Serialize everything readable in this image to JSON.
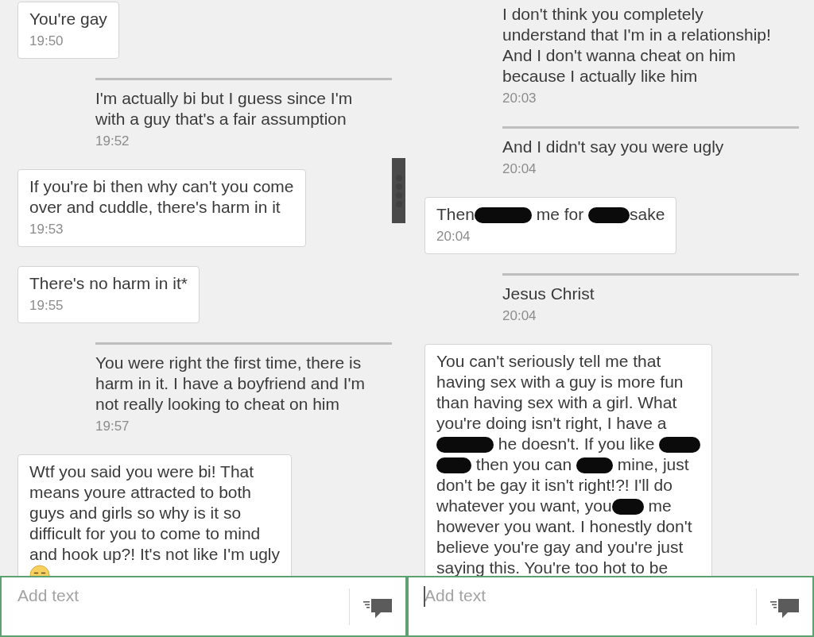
{
  "panels": [
    {
      "messages": [
        {
          "kind": "received",
          "text": "You're gay",
          "time": "19:50"
        },
        {
          "kind": "sent",
          "text": "I'm actually bi but I guess since I'm\nwith a guy that's a fair assumption",
          "time": "19:52"
        },
        {
          "kind": "received",
          "text": "If you're bi then why can't you come\nover and cuddle, there's harm in it",
          "time": "19:53"
        },
        {
          "kind": "received",
          "text": "There's no harm in it*",
          "time": "19:55"
        },
        {
          "kind": "sent",
          "text": "You were right the first time, there is\nharm in it. I have a boyfriend and I'm\nnot really looking to cheat on him",
          "time": "19:57"
        },
        {
          "kind": "received",
          "parts": [
            {
              "kind": "text",
              "text": "Wtf you said you were bi! That\nmeans youre attracted to both\nguys and girls so why is it so\ndifficult for you to come to mind\nand hook up?! It's not like I'm ugly"
            },
            {
              "kind": "break"
            },
            {
              "kind": "emoji"
            }
          ]
        }
      ],
      "scroll_handle": true,
      "compose": {
        "placeholder": "Add text",
        "focused": false
      }
    },
    {
      "messages": [
        {
          "kind": "sent",
          "text": "I don't think you completely\nunderstand that I'm in a relationship!\nAnd I don't wanna cheat on him\nbecause I actually like him",
          "time": "20:03"
        },
        {
          "kind": "sent",
          "text": "And I didn't say you were ugly",
          "time": "20:04"
        },
        {
          "kind": "received",
          "parts": [
            {
              "kind": "text",
              "text": "Then"
            },
            {
              "kind": "redaction"
            },
            {
              "kind": "text",
              "text": " me for "
            },
            {
              "kind": "redaction"
            },
            {
              "kind": "text",
              "text": "sake"
            }
          ],
          "time": "20:04"
        },
        {
          "kind": "sent",
          "text": "Jesus Christ",
          "time": "20:04"
        },
        {
          "kind": "received",
          "parts": [
            {
              "kind": "text",
              "text": "You can't seriously tell me that\nhaving sex with a guy is more fun\nthan having sex with a girl. What\nyou're doing isn't right, I have a"
            },
            {
              "kind": "break"
            },
            {
              "kind": "redaction"
            },
            {
              "kind": "text",
              "text": " he doesn't. If you like "
            },
            {
              "kind": "redaction"
            },
            {
              "kind": "break"
            },
            {
              "kind": "redaction"
            },
            {
              "kind": "text",
              "text": " then you can "
            },
            {
              "kind": "redaction"
            },
            {
              "kind": "text",
              "text": " mine, just\ndon't be gay it isn't right!?! I'll do\nwhatever you want, you"
            },
            {
              "kind": "redaction"
            },
            {
              "kind": "text",
              "text": " me\nhowever you want. I honestly don't\nbelieve you're gay and you're just\nsaying this. You're too hot to be"
            }
          ]
        }
      ],
      "compose": {
        "placeholder": "Add text",
        "focused": true
      }
    }
  ]
}
